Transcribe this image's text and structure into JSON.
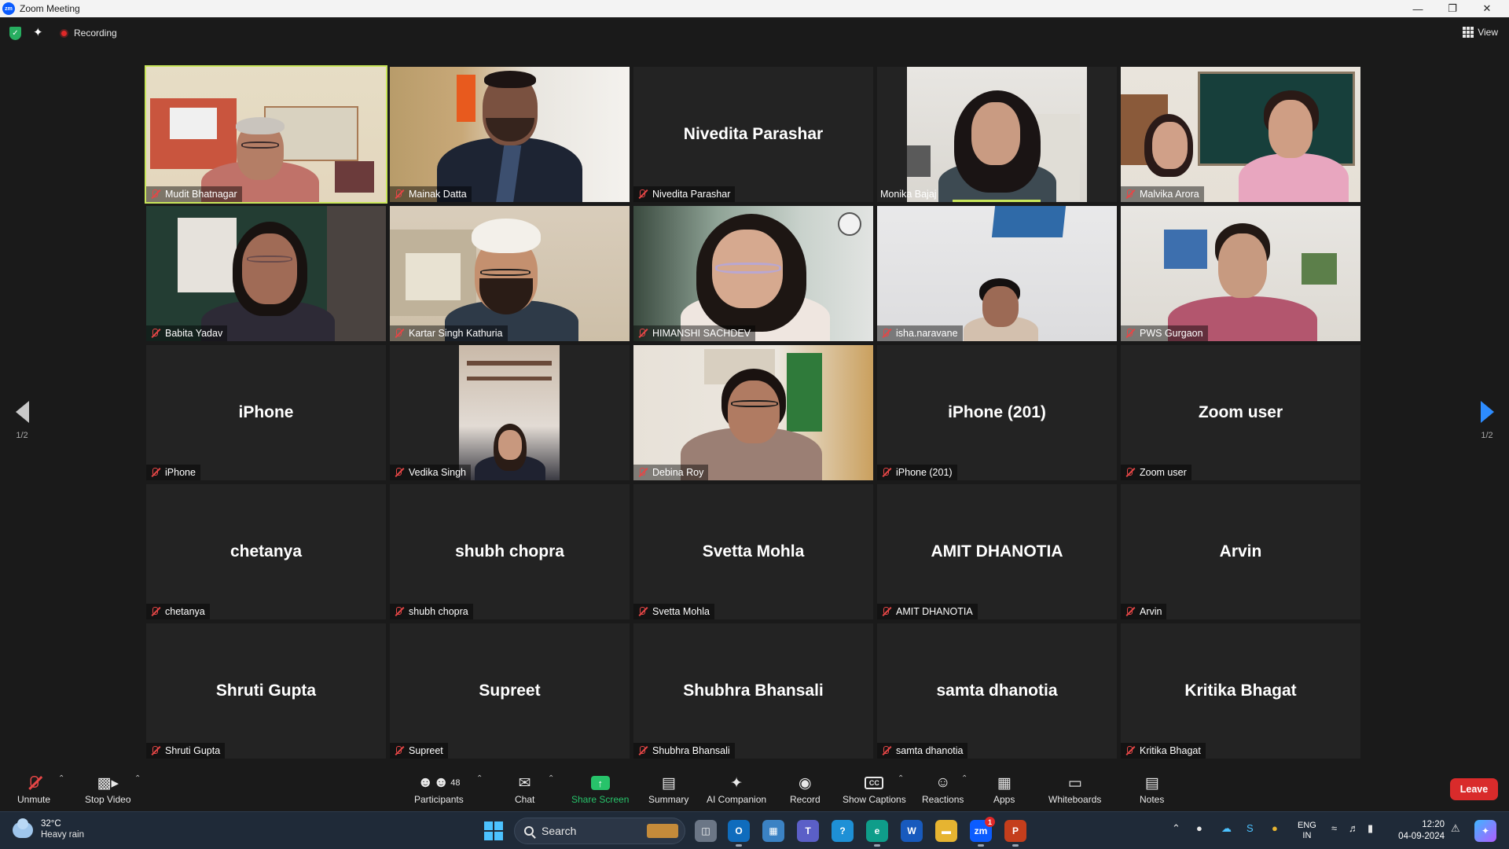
{
  "window": {
    "title": "Zoom Meeting"
  },
  "topbar": {
    "recording_label": "Recording",
    "view_label": "View"
  },
  "participants": [
    {
      "name": "Mudit Bhatnagar",
      "video": true,
      "active": true
    },
    {
      "name": "Mainak Datta",
      "video": true
    },
    {
      "name": "Nivedita Parashar",
      "video": false
    },
    {
      "name": "Monika Bajaj",
      "video": true,
      "speaking": true,
      "muted": false
    },
    {
      "name": "Malvika Arora",
      "video": true
    },
    {
      "name": "Babita Yadav",
      "video": true
    },
    {
      "name": "Kartar Singh Kathuria",
      "video": true
    },
    {
      "name": "HIMANSHI SACHDEV",
      "video": true
    },
    {
      "name": "isha.naravane",
      "video": true
    },
    {
      "name": "PWS Gurgaon",
      "video": true
    },
    {
      "name": "iPhone",
      "video": false
    },
    {
      "name": "Vedika Singh",
      "video": true
    },
    {
      "name": "Debina Roy",
      "video": true
    },
    {
      "name": "iPhone (201)",
      "video": false
    },
    {
      "name": "Zoom user",
      "video": false
    },
    {
      "name": "chetanya",
      "video": false
    },
    {
      "name": "shubh chopra",
      "video": false
    },
    {
      "name": "Svetta Mohla",
      "video": false
    },
    {
      "name": "AMIT DHANOTIA",
      "video": false
    },
    {
      "name": "Arvin",
      "video": false
    },
    {
      "name": "Shruti Gupta",
      "video": false
    },
    {
      "name": "Supreet",
      "video": false
    },
    {
      "name": "Shubhra Bhansali",
      "video": false
    },
    {
      "name": "samta dhanotia",
      "video": false
    },
    {
      "name": "Kritika Bhagat",
      "video": false
    }
  ],
  "pager": {
    "left_label": "1/2",
    "right_label": "1/2"
  },
  "toolbar": {
    "unmute": "Unmute",
    "stop_video": "Stop Video",
    "participants": "Participants",
    "participants_count": "48",
    "chat": "Chat",
    "share_screen": "Share Screen",
    "summary": "Summary",
    "ai_companion": "AI Companion",
    "record": "Record",
    "show_captions": "Show Captions",
    "reactions": "Reactions",
    "apps": "Apps",
    "whiteboards": "Whiteboards",
    "notes": "Notes",
    "leave": "Leave"
  },
  "taskbar": {
    "weather_temp": "32°C",
    "weather_desc": "Heavy rain",
    "search_label": "Search",
    "lang_line1": "ENG",
    "lang_line2": "IN",
    "time": "12:20",
    "date": "04-09-2024",
    "zoom_badge": "1"
  },
  "colors": {
    "accent_green": "#27c36a",
    "leave_red": "#d92b2b",
    "active_border": "#c9e65a",
    "pager_blue": "#2d8cff"
  }
}
